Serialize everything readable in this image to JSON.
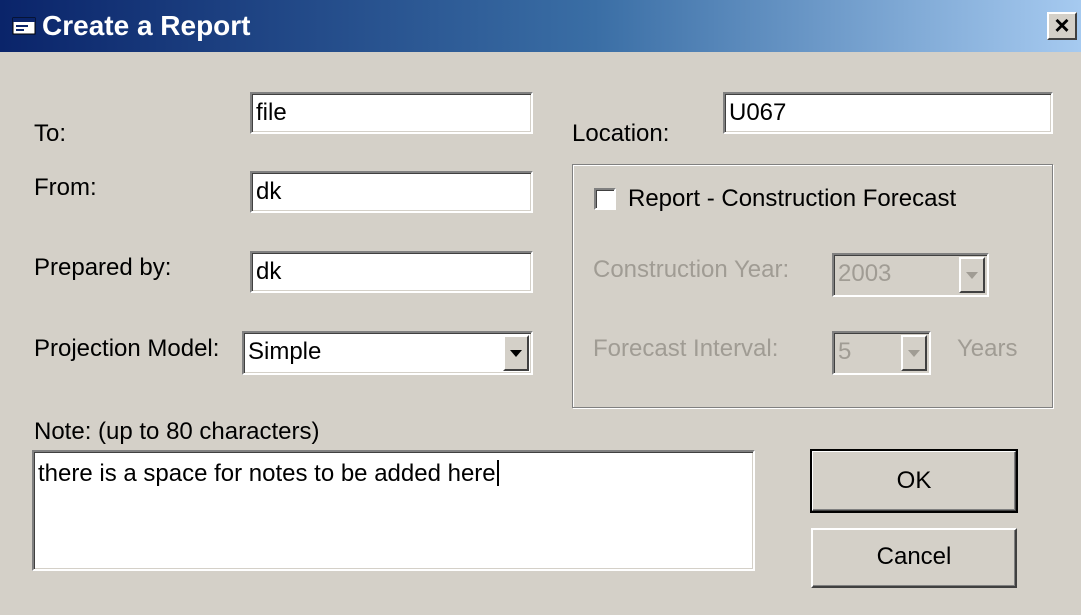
{
  "window": {
    "title": "Create a Report",
    "close_glyph": "×",
    "icon": "app-window-icon"
  },
  "form": {
    "to_label": "To:",
    "to_value": "file",
    "from_label": "From:",
    "from_value": "dk",
    "prepared_by_label": "Prepared by:",
    "prepared_by_value": "dk",
    "projection_model_label": "Projection Model:",
    "projection_model_value": "Simple",
    "location_label": "Location:",
    "location_value": "U067",
    "note_label": "Note:  (up to 80 characters)",
    "note_value": "there is a space for notes to be added here"
  },
  "forecast_group": {
    "checkbox_label": "Report - Construction Forecast",
    "checked": false,
    "construction_year_label": "Construction Year:",
    "construction_year_value": "2003",
    "forecast_interval_label": "Forecast Interval:",
    "forecast_interval_value": "5",
    "years_label": "Years"
  },
  "buttons": {
    "ok_label": "OK",
    "cancel_label": "Cancel"
  },
  "colors": {
    "title_bar_start": "#0a246a",
    "title_bar_end": "#a6caf0",
    "dialog_face": "#d4d0c8",
    "disabled_text": "#a09c94"
  }
}
